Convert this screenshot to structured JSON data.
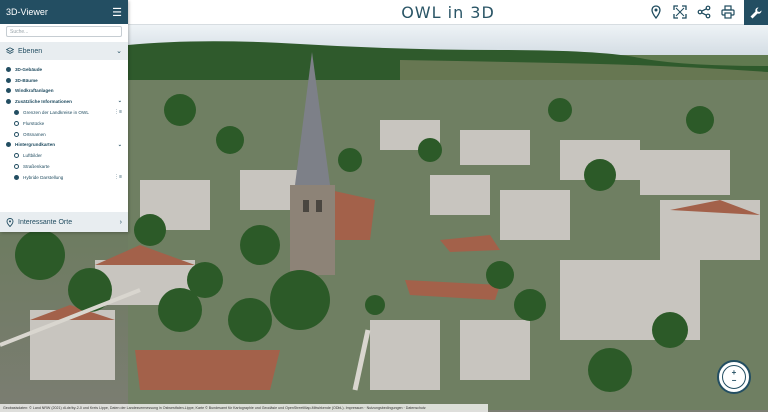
{
  "app": {
    "title": "OWL in 3D"
  },
  "sidebar": {
    "header_title": "3D-Viewer",
    "menu_glyph": "☰",
    "search_placeholder": "Suche...",
    "layers_section": {
      "label": "Ebenen",
      "icon": "layers-icon"
    },
    "layers": [
      {
        "label": "3D-Gebäude",
        "style": "bold",
        "state": "filled"
      },
      {
        "label": "3D-Bäume",
        "style": "bold",
        "state": "filled"
      },
      {
        "label": "Windkraftanlagen",
        "style": "bold",
        "state": "filled"
      },
      {
        "label": "Zusätzliche Informationen",
        "style": "bold",
        "state": "filled",
        "expander": "⌄"
      },
      {
        "label": "Grenzen der Landkreise in OWL",
        "style": "indent",
        "state": "filled",
        "extra": "⋮≡"
      },
      {
        "label": "Flurstücke",
        "style": "indent",
        "state": "empty"
      },
      {
        "label": "Ortsnamen",
        "style": "indent",
        "state": "empty"
      },
      {
        "label": "Hintergrundkarten",
        "style": "bold",
        "state": "filled",
        "expander": "⌄"
      },
      {
        "label": "Luftbilder",
        "style": "indent",
        "state": "empty"
      },
      {
        "label": "Straßenkarte",
        "style": "indent",
        "state": "empty"
      },
      {
        "label": "Hybride Darstellung",
        "style": "indent",
        "state": "filled",
        "extra": "⋮≡"
      }
    ],
    "places_section": {
      "label": "Interessante Orte",
      "icon": "location-pin-icon"
    }
  },
  "toolbar": {
    "tools": [
      {
        "name": "location-pin-icon"
      },
      {
        "name": "fullscreen-icon"
      },
      {
        "name": "share-icon"
      },
      {
        "name": "print-icon"
      },
      {
        "name": "wrench-icon"
      }
    ]
  },
  "zoom": {
    "plus": "+",
    "minus": "−"
  },
  "attribution": "Geobasisdaten: © Land NRW (2021) dl-de/by-2-0 und Kreis Lippe, Daten der Landesvermessung in Ostwestfalen-Lippe, Karte © Bundesamt für Kartographie und Geodäsie und OpenStreetMap-Mitwirkende (ODbL). Impressum · Nutzungsbedingungen · Datenschutz",
  "colors": {
    "primary": "#234e62",
    "sky": "#dde6ec",
    "tree": "#2e5a2a",
    "roof_red": "#a5624a",
    "building": "#c9c6c0"
  }
}
